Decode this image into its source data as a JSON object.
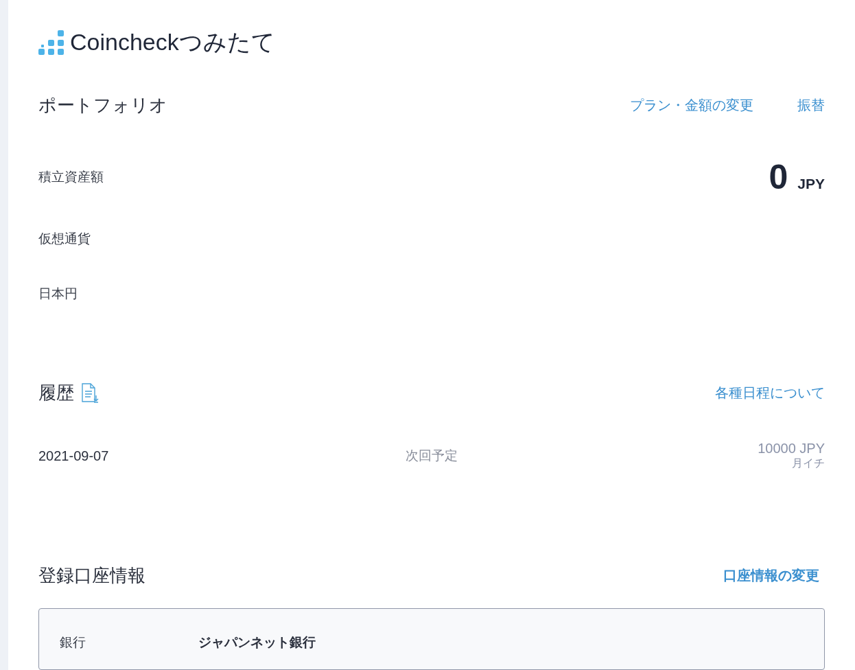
{
  "header": {
    "logo_text": "Coincheckつみたて"
  },
  "portfolio": {
    "title": "ポートフォリオ",
    "links": [
      "プラン・金額の変更",
      "振替"
    ],
    "total": {
      "label": "積立資産額",
      "amount": "0",
      "unit": "JPY"
    },
    "rows": [
      "仮想通貨",
      "日本円"
    ]
  },
  "history": {
    "title": "履歴",
    "link": "各種日程について",
    "entries": [
      {
        "date": "2021-09-07",
        "status": "次回予定",
        "amount": "10000 JPY",
        "frequency": "月イチ"
      }
    ]
  },
  "account": {
    "title": "登録口座情報",
    "link": "口座情報の変更",
    "fields": [
      {
        "label": "銀行",
        "value": "ジャパンネット銀行"
      }
    ]
  }
}
